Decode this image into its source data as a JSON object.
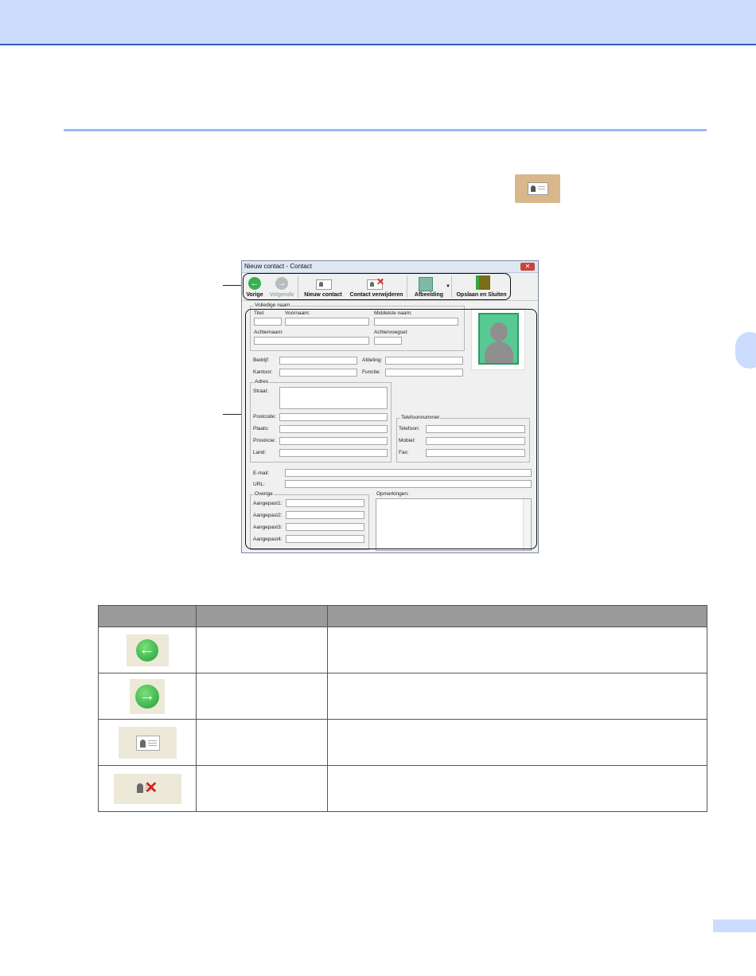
{
  "window": {
    "title": "Nieuw contact - Contact",
    "close_glyph": "✕",
    "toolbar": {
      "prev_label": "Vorige",
      "next_label": "Volgende",
      "new_contact_label": "Nieuw contact",
      "delete_contact_label": "Contact verwijderen",
      "picture_label": "Afbeelding",
      "save_close_label": "Opslaan en Sluiten"
    },
    "form": {
      "fullname_group": "Volledige naam",
      "title_label": "Titel:",
      "firstname_label": "Voornaam:",
      "middlename_label": "Middelste naam:",
      "lastname_label": "Achternaam:",
      "suffix_label": "Achtervoegsel:",
      "company_label": "Bedrijf:",
      "department_label": "Afdeling:",
      "office_label": "Kantoor:",
      "function_label": "Functie:",
      "address_group": "Adres",
      "street_label": "Straat:",
      "postcode_label": "Postcode:",
      "city_label": "Plaats:",
      "province_label": "Provincie:",
      "country_label": "Land:",
      "phone_group": "Telefoonnummer",
      "phone_label": "Telefoon:",
      "mobile_label": "Mobiel:",
      "fax_label": "Fax:",
      "email_label": "E-mail:",
      "url_label": "URL:",
      "other_group": "Overige",
      "custom1_label": "Aangepast1:",
      "custom2_label": "Aangepast2:",
      "custom3_label": "Aangepast3:",
      "custom4_label": "Aangepast4:",
      "notes_label": "Opmerkingen:"
    }
  },
  "icons": {
    "inline": "contact-card-icon",
    "rows": [
      "back-arrow-icon",
      "forward-arrow-icon",
      "new-contact-icon",
      "delete-contact-icon"
    ]
  },
  "colors": {
    "band": "#ccdcff",
    "band_border": "#2f5fae",
    "rule": "#9db9f2",
    "table_header": "#9a9a9a",
    "icon_green": "#37b24d"
  }
}
